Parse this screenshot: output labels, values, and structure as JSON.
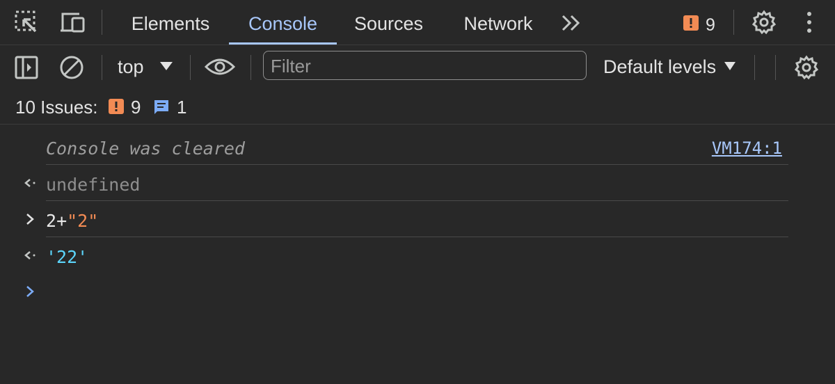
{
  "tabs": {
    "elements": "Elements",
    "console": "Console",
    "sources": "Sources",
    "network": "Network"
  },
  "topbar": {
    "issues_badge_count": "9"
  },
  "toolbar": {
    "context": "top",
    "filter_placeholder": "Filter",
    "filter_value": "",
    "levels": "Default levels"
  },
  "issues": {
    "label": "10 Issues:",
    "warnings_count": "9",
    "info_count": "1"
  },
  "console": {
    "cleared_message": "Console was cleared",
    "cleared_source": "VM174:1",
    "result_1": "undefined",
    "input_1_number": "2",
    "input_1_operator": "+",
    "input_1_string": "\"2\"",
    "result_2": "'22'"
  },
  "colors": {
    "background": "#282828",
    "accent": "#a8c7fa",
    "warning": "#f28b54",
    "info": "#7cacf8",
    "string_result": "#5cd5fb"
  },
  "icons": [
    "inspect-element-icon",
    "device-toolbar-icon",
    "more-tabs-icon",
    "warning-icon",
    "settings-icon",
    "more-options-icon",
    "sidebar-toggle-icon",
    "clear-console-icon",
    "dropdown-arrow-icon",
    "live-expression-eye-icon",
    "info-message-icon",
    "result-arrow-icon",
    "input-chevron-icon",
    "prompt-chevron-icon"
  ]
}
